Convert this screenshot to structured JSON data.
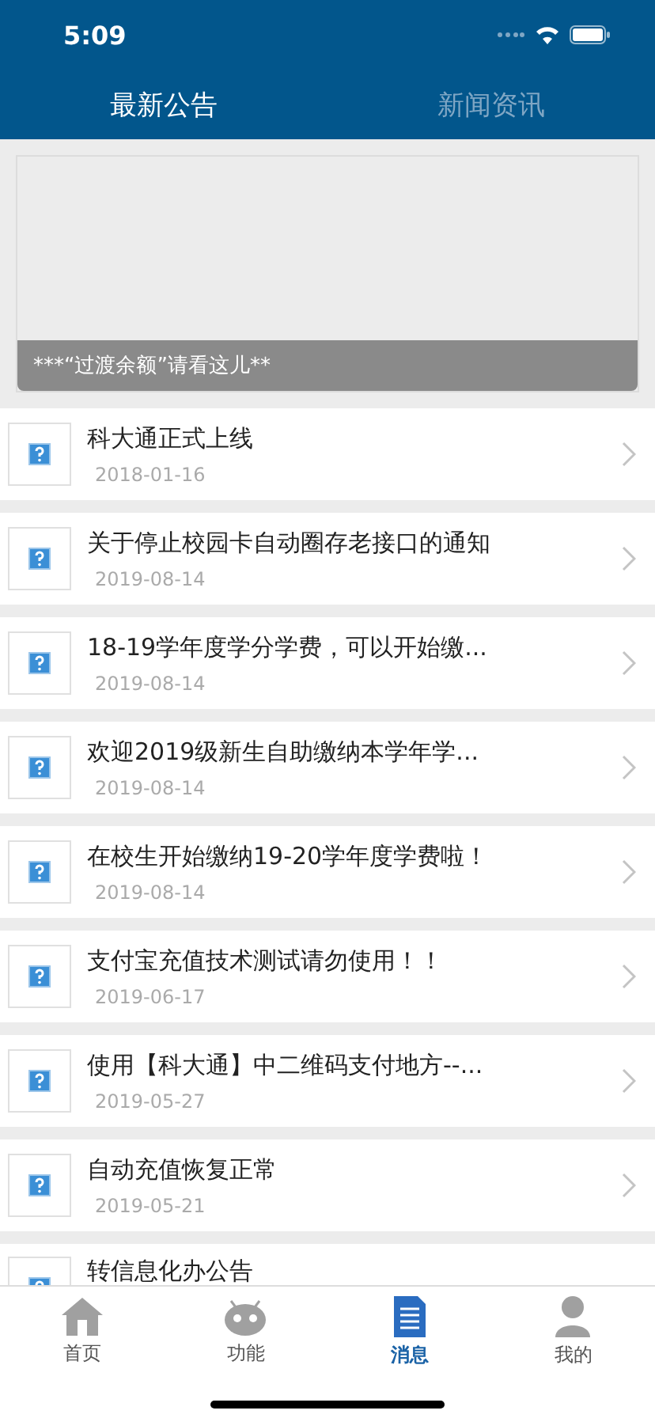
{
  "status_bar": {
    "time": "5:09"
  },
  "tabs": [
    {
      "label": "最新公告",
      "selected": true
    },
    {
      "label": "新闻资讯",
      "selected": false
    }
  ],
  "banner": {
    "caption": "***“过渡余额”请看这儿**"
  },
  "notices": [
    {
      "title": "科大通正式上线",
      "date": "2018-01-16"
    },
    {
      "title": "关于停止校园卡自动圈存老接口的通知",
      "date": "2019-08-14"
    },
    {
      "title": "18-19学年度学分学费，可以开始缴...",
      "date": "2019-08-14"
    },
    {
      "title": "欢迎2019级新生自助缴纳本学年学...",
      "date": "2019-08-14"
    },
    {
      "title": "在校生开始缴纳19-20学年度学费啦！",
      "date": "2019-08-14"
    },
    {
      "title": "支付宝充值技术测试请勿使用！！",
      "date": "2019-06-17"
    },
    {
      "title": "使用【科大通】中二维码支付地方--...",
      "date": "2019-05-27"
    },
    {
      "title": "自动充值恢复正常",
      "date": "2019-05-21"
    },
    {
      "title": "转信息化办公告"
    }
  ],
  "bottom_nav": [
    {
      "label": "首页",
      "kind": "home",
      "selected": false
    },
    {
      "label": "功能",
      "kind": "robot",
      "selected": false
    },
    {
      "label": "消息",
      "kind": "document",
      "selected": true
    },
    {
      "label": "我的",
      "kind": "person",
      "selected": false
    }
  ]
}
